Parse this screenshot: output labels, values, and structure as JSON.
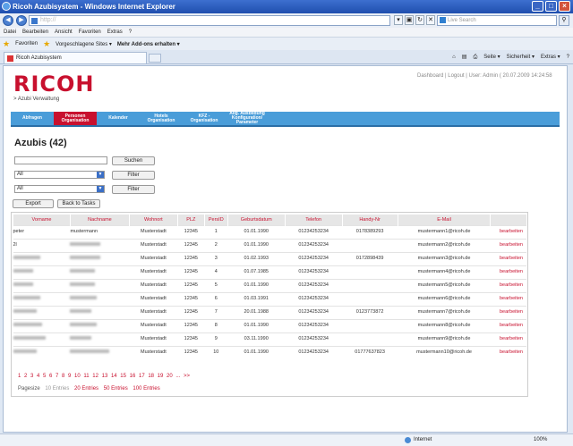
{
  "window": {
    "title": "Ricoh Azubisystem - Windows Internet Explorer",
    "controls": [
      "_",
      "□",
      "×"
    ]
  },
  "address": {
    "url": "http://"
  },
  "search": {
    "placeholder": "Live Search"
  },
  "menu": [
    "Datei",
    "Bearbeiten",
    "Ansicht",
    "Favoriten",
    "Extras",
    "?"
  ],
  "favbar": {
    "favorites": "Favoriten",
    "suggested": "Vorgeschlagene Sites ▾",
    "addons": "Mehr Add-ons erhalten ▾"
  },
  "tab": {
    "title": "Ricoh Azubisystem"
  },
  "toolbar": {
    "seite": "Seite ▾",
    "sicherheit": "Sicherheit ▾",
    "extras": "Extras ▾"
  },
  "site": {
    "logo": "RICOH",
    "subtitle": "> Azubi Verwaltung",
    "toplinks": "Dashboard | Logout | User: Admin     ( 20.07.2009 14:24:58"
  },
  "nav": [
    "Abfragen",
    "Personen Organisation",
    "Kalender",
    "Hotels Organisation",
    "KFZ - Organisation",
    "Allg. Ausbildung Konfiguration/ Parameter"
  ],
  "heading": "Azubis (42)",
  "controls": {
    "suchen": "Suchen",
    "all1": "All",
    "filter1": "Filter",
    "all2": "All",
    "filter2": "Filter",
    "export": "Export",
    "back": "Back to Tasks"
  },
  "table": {
    "headers": [
      "Vorname",
      "Nachname",
      "Wohnort",
      "PLZ",
      "PersID",
      "Geburtsdatum",
      "Telefon",
      "Handy-Nr",
      "E-Mail",
      ""
    ],
    "rows": [
      {
        "vorname": "peter",
        "nachname": "mustermann",
        "wohnort": "Musterstadt",
        "plz": "12345",
        "id": "1",
        "geb": "01.01.1990",
        "tel": "01234253234",
        "handy": "0178389293",
        "email": "mustermann1@ricoh.de",
        "action": "bearbeiten"
      },
      {
        "vorname": "2l",
        "nachname": "",
        "wohnort": "Musterstadt",
        "plz": "12345",
        "id": "2",
        "geb": "01.01.1990",
        "tel": "01234253234",
        "handy": "",
        "email": "mustermann2@ricoh.de",
        "action": "bearbeiten"
      },
      {
        "vorname": "",
        "nachname": "",
        "wohnort": "Musterstadt",
        "plz": "12345",
        "id": "3",
        "geb": "01.02.1993",
        "tel": "01234253234",
        "handy": "0172898439",
        "email": "mustermann3@ricoh.de",
        "action": "bearbeiten"
      },
      {
        "vorname": "",
        "nachname": "",
        "wohnort": "Musterstadt",
        "plz": "12345",
        "id": "4",
        "geb": "01.07.1985",
        "tel": "01234253234",
        "handy": "",
        "email": "mustermann4@ricoh.de",
        "action": "bearbeiten"
      },
      {
        "vorname": "",
        "nachname": "",
        "wohnort": "Musterstadt",
        "plz": "12345",
        "id": "5",
        "geb": "01.01.1990",
        "tel": "01234253234",
        "handy": "",
        "email": "mustermann5@ricoh.de",
        "action": "bearbeiten"
      },
      {
        "vorname": "",
        "nachname": "",
        "wohnort": "Musterstadt",
        "plz": "12345",
        "id": "6",
        "geb": "01.03.1991",
        "tel": "01234253234",
        "handy": "",
        "email": "mustermann6@ricoh.de",
        "action": "bearbeiten"
      },
      {
        "vorname": "",
        "nachname": "",
        "wohnort": "Musterstadt",
        "plz": "12345",
        "id": "7",
        "geb": "20.01.1988",
        "tel": "01234253234",
        "handy": "0123773872",
        "email": "mustermann7@ricoh.de",
        "action": "bearbeiten"
      },
      {
        "vorname": "",
        "nachname": "",
        "wohnort": "Musterstadt",
        "plz": "12345",
        "id": "8",
        "geb": "01.01.1990",
        "tel": "01234253234",
        "handy": "",
        "email": "mustermann8@ricoh.de",
        "action": "bearbeiten"
      },
      {
        "vorname": "",
        "nachname": "",
        "wohnort": "Musterstadt",
        "plz": "12345",
        "id": "9",
        "geb": "03.11.1990",
        "tel": "01234253234",
        "handy": "",
        "email": "mustermann9@ricoh.de",
        "action": "bearbeiten"
      },
      {
        "vorname": "",
        "nachname": "",
        "wohnort": "Musterstadt",
        "plz": "12345",
        "id": "10",
        "geb": "01.01.1990",
        "tel": "01234253234",
        "handy": "01777637823",
        "email": "mustermann10@ricoh.de",
        "action": "bearbeiten"
      }
    ]
  },
  "pager": {
    "pages": "1 2 3 4 5 6 7 8 9 10 11 12 13 14 15 16 17 18 19 20 ... >>",
    "label": "Pagesize",
    "current": "10 Entries",
    "opt20": "20 Entries",
    "opt50": "50 Entries",
    "opt100": "100 Entries"
  },
  "status": {
    "zone": "Internet",
    "zoom": "100%"
  }
}
